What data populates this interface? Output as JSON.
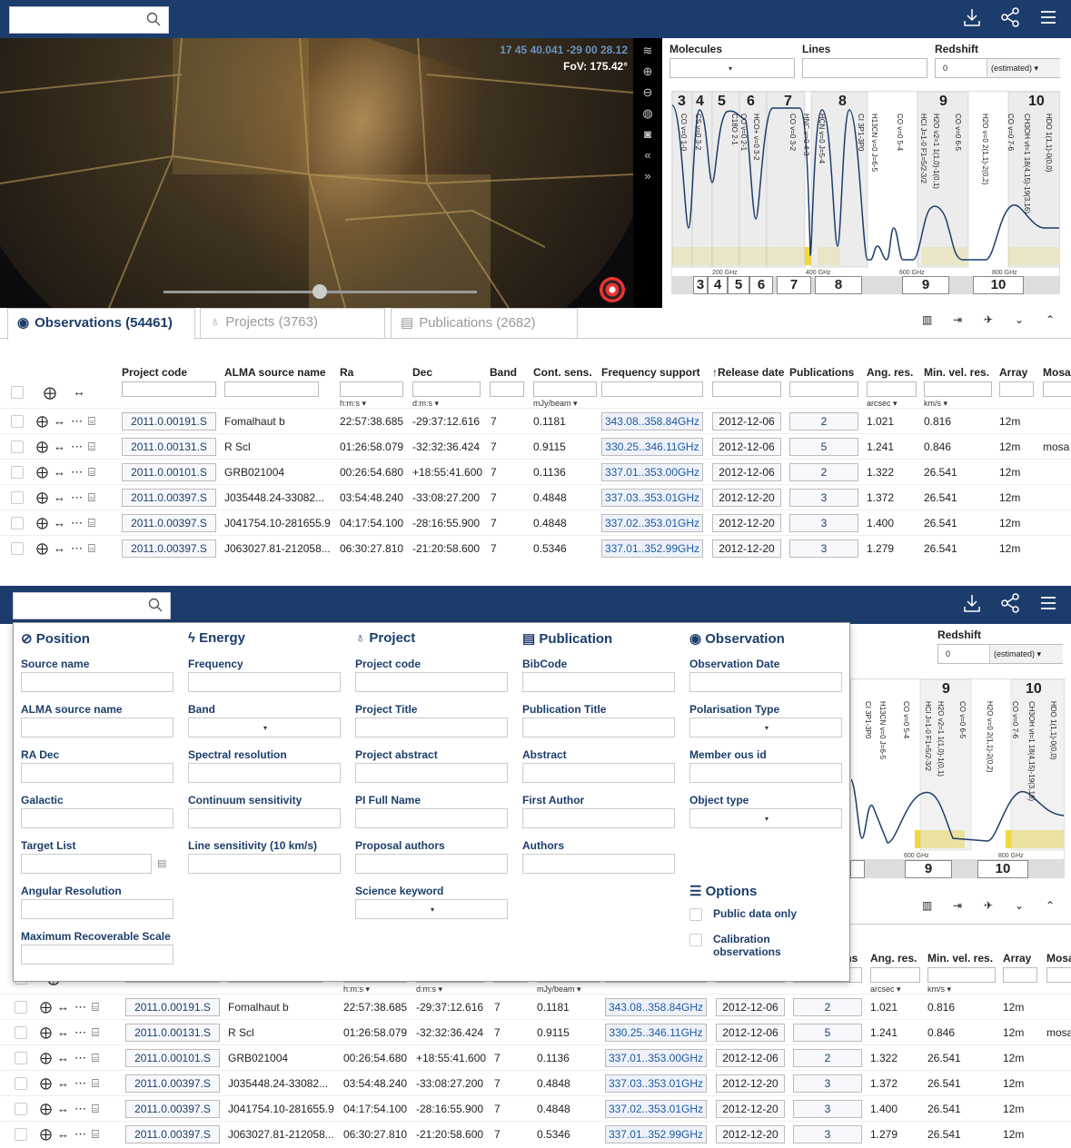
{
  "header": {
    "search_placeholder": "",
    "icons": [
      "search-icon",
      "download-icon",
      "share-icon",
      "menu-icon"
    ]
  },
  "sky": {
    "coords": "17 45 40.041 -29 00 28.12",
    "fov": "FoV: 175.42°",
    "tool_icons": [
      "layers-icon",
      "zoom-in-icon",
      "zoom-out-icon",
      "globe-icon",
      "camera-icon",
      "collapse-icon",
      "expand-icon"
    ]
  },
  "spectrum": {
    "molecules_label": "Molecules",
    "lines_label": "Lines",
    "redshift_label": "Redshift",
    "redshift_value": "0",
    "redshift_mode": "(estimated)",
    "band_numbers": [
      "3",
      "4",
      "5",
      "6",
      "7",
      "8",
      "9",
      "10"
    ],
    "lines": [
      "CO v=0 1-0",
      "CS v=0 3-2",
      "C18O 2-1",
      "CO v=0 2-1",
      "HCO+ v=0 3-2",
      "CO v=0 3-2",
      "HNC v=0 4-3",
      "HCN v=0 J=5-4",
      "CI 3P1-3P0",
      "H13CN v=0 J=6-5",
      "CO v=0 5-4",
      "HCl J=1-0 F1=5/2-3/2",
      "H2O v2=1 1(1,0)-1(0,1)",
      "CO v=0 6-5",
      "H2O v=0 2(1,1)-2(0,2)",
      "CO v=0 7-6",
      "CH3OH vt=1 18(4,15)-19(3,16)",
      "HDO 1(1,1)-0(0,0)"
    ],
    "ghz_labels": [
      "200 GHz",
      "400 GHz",
      "600 GHz",
      "800 GHz"
    ],
    "strip": [
      "3",
      "4",
      "5",
      "6",
      "7",
      "8",
      "9",
      "10"
    ]
  },
  "tabs": [
    {
      "label": "Observations (54461)",
      "icon": "eye-icon"
    },
    {
      "label": "Projects (3763)",
      "icon": "bulb-icon"
    },
    {
      "label": "Publications (2682)",
      "icon": "book-icon"
    }
  ],
  "tab_tools": [
    "columns-icon",
    "export-icon",
    "rocket-icon",
    "chevron-down-double-icon",
    "chevron-up-icon"
  ],
  "table": {
    "headers": [
      "Project code",
      "ALMA source name",
      "Ra",
      "Dec",
      "Band",
      "Cont. sens.",
      "Frequency support",
      "↑Release date",
      "Publications",
      "Ang. res.",
      "Min. vel. res.",
      "Array",
      "Mosa"
    ],
    "units": {
      "ra": "h:m:s ▾",
      "dec": "d:m:s ▾",
      "cont": "mJy/beam ▾",
      "ang": "arcsec ▾",
      "vel": "km/s ▾"
    },
    "rows": [
      {
        "code": "2011.0.00191.S",
        "name": "Fomalhaut b",
        "ra": "22:57:38.685",
        "dec": "-29:37:12.616",
        "band": "7",
        "cont": "0.1181",
        "freq": "343.08..358.84GHz",
        "date": "2012-12-06",
        "pubs": "2",
        "ang": "1.021",
        "vel": "0.816",
        "array": "12m",
        "mosaic": ""
      },
      {
        "code": "2011.0.00131.S",
        "name": "R Scl",
        "ra": "01:26:58.079",
        "dec": "-32:32:36.424",
        "band": "7",
        "cont": "0.9115",
        "freq": "330.25..346.11GHz",
        "date": "2012-12-06",
        "pubs": "5",
        "ang": "1.241",
        "vel": "0.846",
        "array": "12m",
        "mosaic": "mosa"
      },
      {
        "code": "2011.0.00101.S",
        "name": "GRB021004",
        "ra": "00:26:54.680",
        "dec": "+18:55:41.600",
        "band": "7",
        "cont": "0.1136",
        "freq": "337.01..353.00GHz",
        "date": "2012-12-06",
        "pubs": "2",
        "ang": "1.322",
        "vel": "26.541",
        "array": "12m",
        "mosaic": ""
      },
      {
        "code": "2011.0.00397.S",
        "name": "J035448.24-33082...",
        "ra": "03:54:48.240",
        "dec": "-33:08:27.200",
        "band": "7",
        "cont": "0.4848",
        "freq": "337.03..353.01GHz",
        "date": "2012-12-20",
        "pubs": "3",
        "ang": "1.372",
        "vel": "26.541",
        "array": "12m",
        "mosaic": ""
      },
      {
        "code": "2011.0.00397.S",
        "name": "J041754.10-281655.9",
        "ra": "04:17:54.100",
        "dec": "-28:16:55.900",
        "band": "7",
        "cont": "0.4848",
        "freq": "337.02..353.01GHz",
        "date": "2012-12-20",
        "pubs": "3",
        "ang": "1.400",
        "vel": "26.541",
        "array": "12m",
        "mosaic": ""
      },
      {
        "code": "2011.0.00397.S",
        "name": "J063027.81-212058...",
        "ra": "06:30:27.810",
        "dec": "-21:20:58.600",
        "band": "7",
        "cont": "0.5346",
        "freq": "337.01..352.99GHz",
        "date": "2012-12-20",
        "pubs": "3",
        "ang": "1.279",
        "vel": "26.541",
        "array": "12m",
        "mosaic": ""
      }
    ]
  },
  "search_panel": {
    "columns": [
      {
        "title": "Position",
        "icon": "compass-icon",
        "fields": [
          "Source name",
          "ALMA source name",
          "RA Dec",
          "Galactic",
          "Target List",
          "Angular Resolution",
          "Maximum Recoverable Scale"
        ]
      },
      {
        "title": "Energy",
        "icon": "bolt-icon",
        "fields": [
          "Frequency",
          "Band",
          "Spectral resolution",
          "Continuum sensitivity",
          "Line sensitivity (10 km/s)"
        ]
      },
      {
        "title": "Project",
        "icon": "bulb-icon",
        "fields": [
          "Project code",
          "Project Title",
          "Project abstract",
          "PI Full Name",
          "Proposal authors",
          "Science keyword"
        ]
      },
      {
        "title": "Publication",
        "icon": "book-icon",
        "fields": [
          "BibCode",
          "Publication Title",
          "Abstract",
          "First Author",
          "Authors"
        ]
      },
      {
        "title": "Observation",
        "icon": "eye-icon",
        "fields": [
          "Observation Date",
          "Polarisation Type",
          "Member ous id",
          "Object type"
        ]
      }
    ],
    "options_title": "Options",
    "options": [
      "Public data only",
      "Calibration observations"
    ]
  },
  "colors": {
    "navy": "#1c3d6b",
    "yellow": "#f2d93a",
    "link": "#1c5aa8"
  }
}
